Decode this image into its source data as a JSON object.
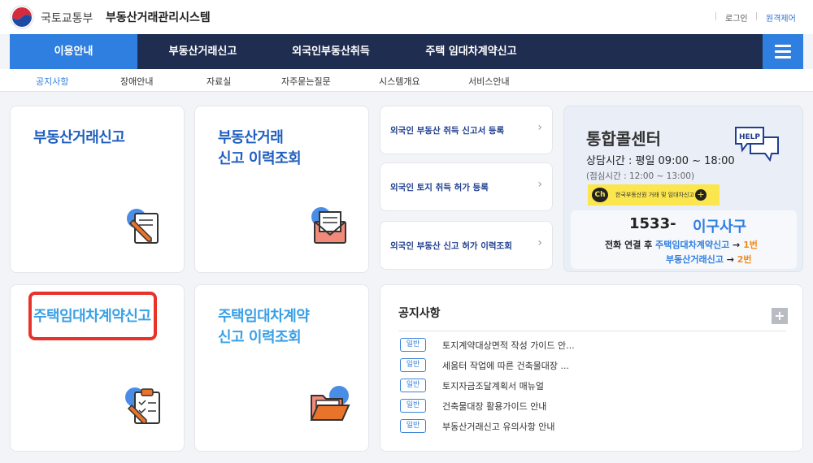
{
  "header": {
    "ministry": "국토교통부",
    "system_name": "부동산거래관리시스템",
    "login": "로그인",
    "remote": "원격제어"
  },
  "gnb": {
    "items": [
      "이용안내",
      "부동산거래신고",
      "외국인부동산취득",
      "주택 임대차계약신고"
    ],
    "active_index": 0
  },
  "lnb": {
    "items": [
      "공지사항",
      "장애안내",
      "자료실",
      "자주묻는질문",
      "시스템개요",
      "서비스안내"
    ],
    "active_index": 0
  },
  "cards": {
    "report": "부동산거래신고",
    "history_1": "부동산거래",
    "history_2": "신고 이력조회",
    "lease": "주택임대차계약신고",
    "lease_history_1": "주택임대차계약",
    "lease_history_2": "신고 이력조회"
  },
  "links": [
    "외국인 부동산 취득 신고서 등록",
    "외국인 토지 취득 허가 등록",
    "외국인 부동산 신고 허가 이력조회"
  ],
  "call_center": {
    "title": "통합콜센터",
    "hours": "상담시간 : 평일 09:00 ~ 18:00",
    "lunch": "(점심시간 : 12:00 ~ 13:00)",
    "kakao_ch": "Ch",
    "kakao_text": "한국부동산원 거래 및 임대차신고",
    "number": "1533-",
    "number_kr": "이구사구",
    "line1_prefix": "전화 연결 후",
    "line1_service": "주택임대차계약신고",
    "line1_arrow": "→",
    "line1_key": "1번",
    "line2_service": "부동산거래신고",
    "line2_arrow": "→",
    "line2_key": "2번",
    "help": "HELP"
  },
  "notice": {
    "title": "공지사항",
    "more": "+",
    "badge": "일반",
    "items": [
      "토지계약대상면적 작성 가이드 안...",
      "세움터 작업에 따른 건축물대장 ...",
      "토지자금조달계획서 매뉴얼",
      "건축물대장 활용가이드 안내",
      "부동산거래신고 유의사항 안내"
    ]
  },
  "colors": {
    "nav_bg": "#1f2d51",
    "accent": "#2f7fe0",
    "highlight": "#e8322a",
    "kakao": "#fbe64d"
  }
}
